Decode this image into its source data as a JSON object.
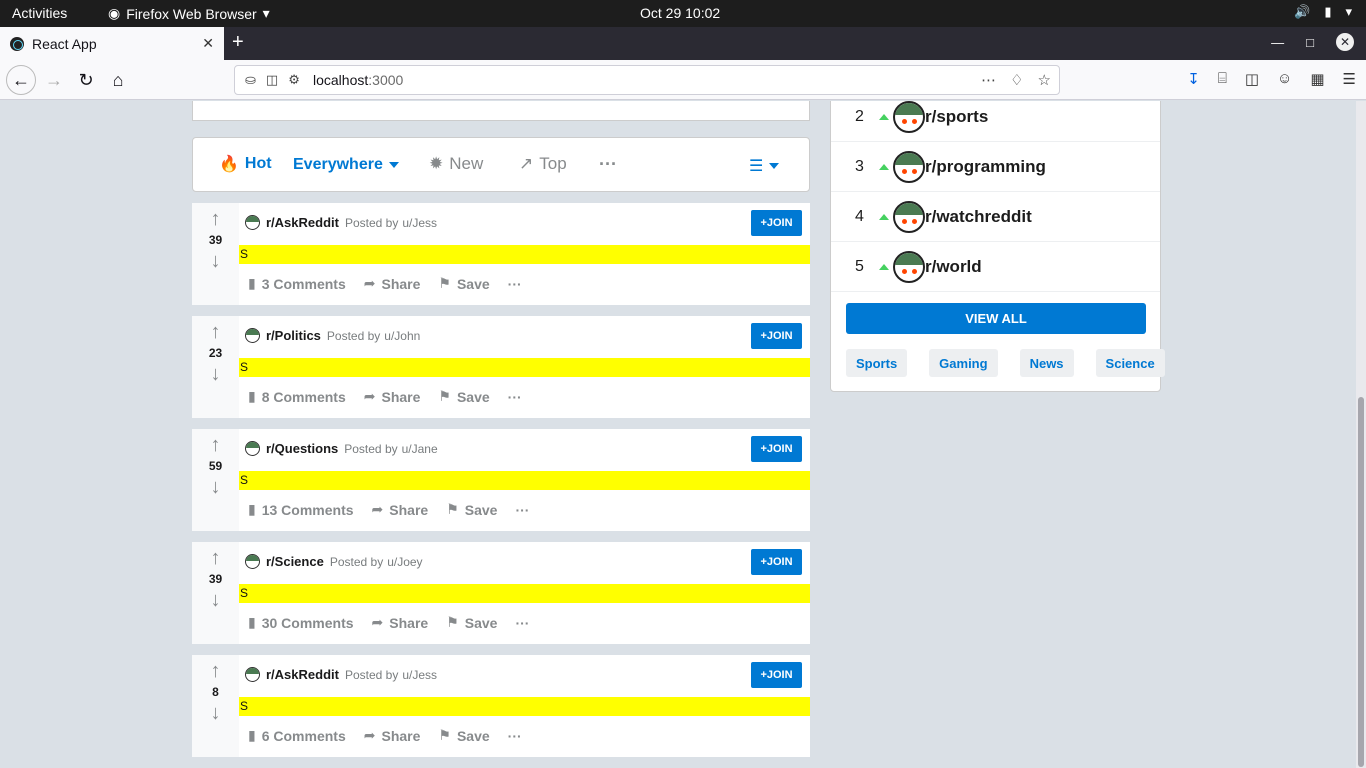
{
  "system_bar": {
    "activities": "Activities",
    "app_name": "Firefox Web Browser",
    "clock": "Oct 29  10:02"
  },
  "browser": {
    "tab_title": "React App",
    "url_host": "localhost",
    "url_port": ":3000"
  },
  "sort_bar": {
    "hot": "Hot",
    "everywhere": "Everywhere",
    "new": "New",
    "top": "Top",
    "more": "···"
  },
  "posts": [
    {
      "votes": "39",
      "subreddit": "r/AskReddit",
      "posted_by": "Posted by",
      "user": "u/Jess",
      "join": "+JOIN",
      "title": "S",
      "comments": "3 Comments",
      "share": "Share",
      "save": "Save",
      "more": "···"
    },
    {
      "votes": "23",
      "subreddit": "r/Politics",
      "posted_by": "Posted by",
      "user": "u/John",
      "join": "+JOIN",
      "title": "S",
      "comments": "8 Comments",
      "share": "Share",
      "save": "Save",
      "more": "···"
    },
    {
      "votes": "59",
      "subreddit": "r/Questions",
      "posted_by": "Posted by",
      "user": "u/Jane",
      "join": "+JOIN",
      "title": "S",
      "comments": "13 Comments",
      "share": "Share",
      "save": "Save",
      "more": "···"
    },
    {
      "votes": "39",
      "subreddit": "r/Science",
      "posted_by": "Posted by",
      "user": "u/Joey",
      "join": "+JOIN",
      "title": "S",
      "comments": "30 Comments",
      "share": "Share",
      "save": "Save",
      "more": "···"
    },
    {
      "votes": "8",
      "subreddit": "r/AskReddit",
      "posted_by": "Posted by",
      "user": "u/Jess",
      "join": "+JOIN",
      "title": "S",
      "comments": "6 Comments",
      "share": "Share",
      "save": "Save",
      "more": "···"
    }
  ],
  "sidebar": {
    "communities": [
      {
        "rank": "2",
        "name": "r/sports"
      },
      {
        "rank": "3",
        "name": "r/programming"
      },
      {
        "rank": "4",
        "name": "r/watchreddit"
      },
      {
        "rank": "5",
        "name": "r/world"
      }
    ],
    "view_all": "VIEW ALL",
    "topics": [
      "Sports",
      "Gaming",
      "News",
      "Science"
    ]
  },
  "colors": {
    "accent": "#0079d3",
    "title_highlight": "#ffff00",
    "page_bg": "#dae0e6",
    "upvote_green": "#46d160"
  }
}
